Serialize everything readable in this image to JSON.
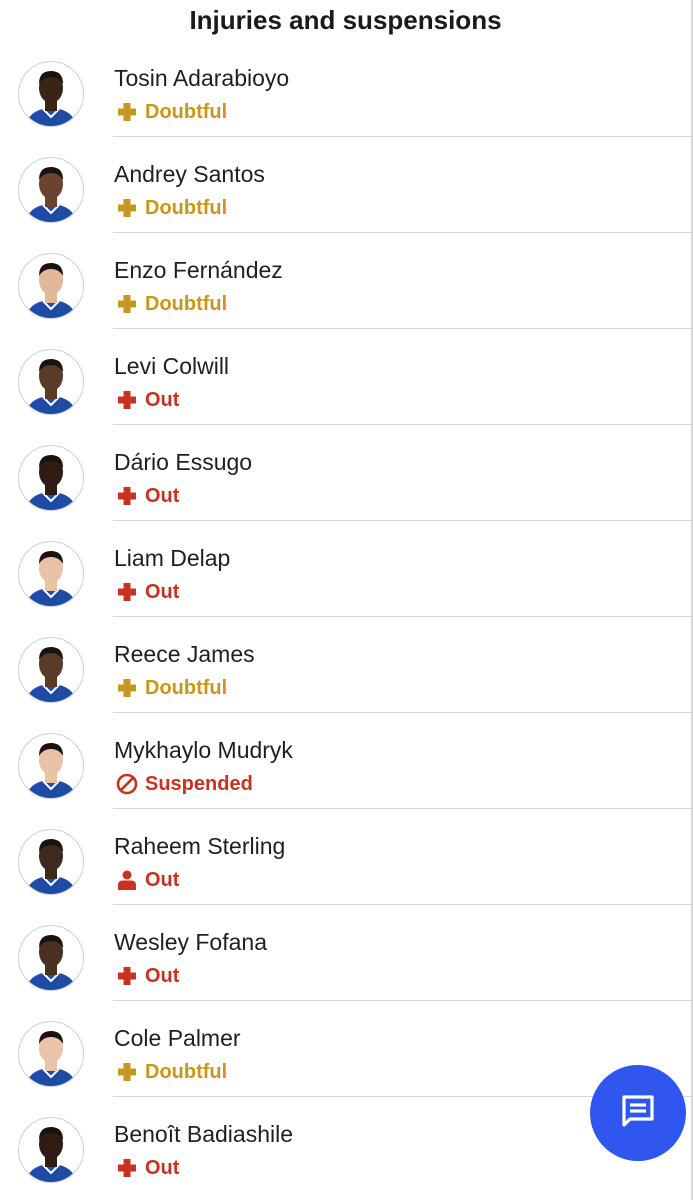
{
  "header": {
    "title": "Injuries and suspensions"
  },
  "colors": {
    "doubtful": "#c9971c",
    "out": "#c8321f",
    "fab": "#2f56ee"
  },
  "players": [
    {
      "name": "Tosin Adarabioyo",
      "status": "Doubtful",
      "type": "doubtful",
      "icon": "plus-icon",
      "skin": "#3a2418"
    },
    {
      "name": "Andrey Santos",
      "status": "Doubtful",
      "type": "doubtful",
      "icon": "plus-icon",
      "skin": "#6a4430"
    },
    {
      "name": "Enzo Fernández",
      "status": "Doubtful",
      "type": "doubtful",
      "icon": "plus-icon",
      "skin": "#e3b89a"
    },
    {
      "name": "Levi Colwill",
      "status": "Out",
      "type": "out",
      "icon": "plus-icon",
      "skin": "#5a3a28"
    },
    {
      "name": "Dário Essugo",
      "status": "Out",
      "type": "out",
      "icon": "plus-icon",
      "skin": "#2e1d14"
    },
    {
      "name": "Liam Delap",
      "status": "Out",
      "type": "out",
      "icon": "plus-icon",
      "skin": "#e8c2a4"
    },
    {
      "name": "Reece James",
      "status": "Doubtful",
      "type": "doubtful",
      "icon": "plus-icon",
      "skin": "#5a3a28"
    },
    {
      "name": "Mykhaylo Mudryk",
      "status": "Suspended",
      "type": "out",
      "icon": "ban-icon",
      "skin": "#e8c2a4"
    },
    {
      "name": "Raheem Sterling",
      "status": "Out",
      "type": "out",
      "icon": "person-icon",
      "skin": "#3e2a1e"
    },
    {
      "name": "Wesley Fofana",
      "status": "Out",
      "type": "out",
      "icon": "plus-icon",
      "skin": "#4a3022"
    },
    {
      "name": "Cole Palmer",
      "status": "Doubtful",
      "type": "doubtful",
      "icon": "plus-icon",
      "skin": "#eac4a8"
    },
    {
      "name": "Benoît Badiashile",
      "status": "Out",
      "type": "out",
      "icon": "plus-icon",
      "skin": "#2e1d14"
    }
  ],
  "fab": {
    "icon": "chat-icon"
  }
}
